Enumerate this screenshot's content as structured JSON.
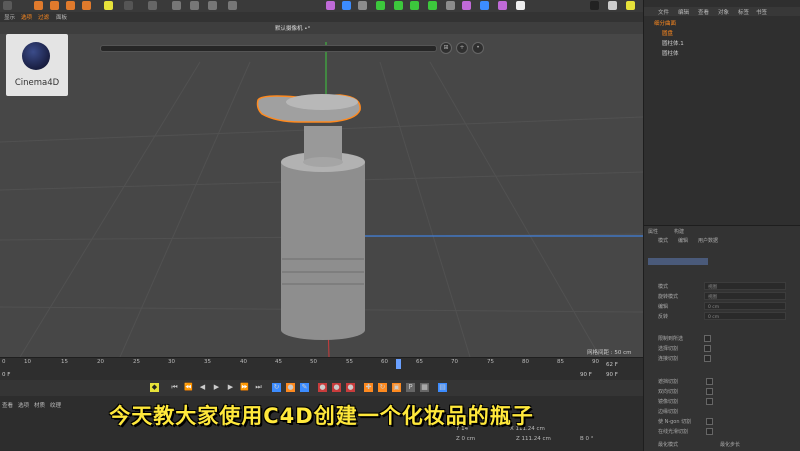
{
  "menu": {
    "items": [
      "显示",
      "选项",
      "过滤",
      "面板"
    ]
  },
  "viewport": {
    "camera_label": "默认摄像机 •°",
    "logo_text": "Cinema4D",
    "grid_spacing": "网格间距 : 50 cm"
  },
  "object_manager": {
    "tabs": [
      "文件",
      "编辑",
      "查看",
      "对象",
      "标签",
      "书签"
    ],
    "objects": [
      "细分曲面",
      "圆盘",
      "圆柱体.1",
      "圆柱体"
    ]
  },
  "attribute_manager": {
    "tabs": [
      "属性",
      "构建"
    ],
    "subtabs": [
      "模式",
      "编辑",
      "用户数据"
    ],
    "rows": [
      {
        "label": "模式",
        "value": "视图"
      },
      {
        "label": "旋转模式",
        "value": "视图"
      },
      {
        "label": "编辑",
        "value": "0 cm"
      },
      {
        "label": "反转",
        "value": "0 cm"
      }
    ],
    "checks": [
      "限制到所选",
      "选择切割",
      "连接切割"
    ],
    "checks2": [
      "遮挡切割",
      "双向切割",
      "镜像切割",
      "边缘切割",
      "使 N-gon 切割",
      "在线光滑切割"
    ],
    "footer": [
      "最化模式",
      "最化步长"
    ]
  },
  "timeline": {
    "ticks": [
      "0",
      "10",
      "15",
      "20",
      "25",
      "30",
      "35",
      "40",
      "45",
      "50",
      "55",
      "60",
      "65",
      "70",
      "75",
      "80",
      "85",
      "90"
    ],
    "start": "0 F",
    "end": "90 F",
    "current": "62 F",
    "end2": "90 F"
  },
  "bottom_menu": [
    "查看",
    "选项",
    "材质",
    "纹理"
  ],
  "coords": {
    "y": "Y  14",
    "x_label": "X  111.24 cm",
    "z": "Z  0 cm",
    "z2": "Z  111.24 cm",
    "b": "B  0 °"
  },
  "subtitle": "今天教大家使用C4D创建一个化妆品的瓶子",
  "colors": {
    "accent_orange": "#ff8a1f",
    "subtitle_yellow": "#ffe83b",
    "axis_green": "#3cc83c",
    "axis_blue": "#3c8cff",
    "axis_red": "#c83c3c"
  }
}
